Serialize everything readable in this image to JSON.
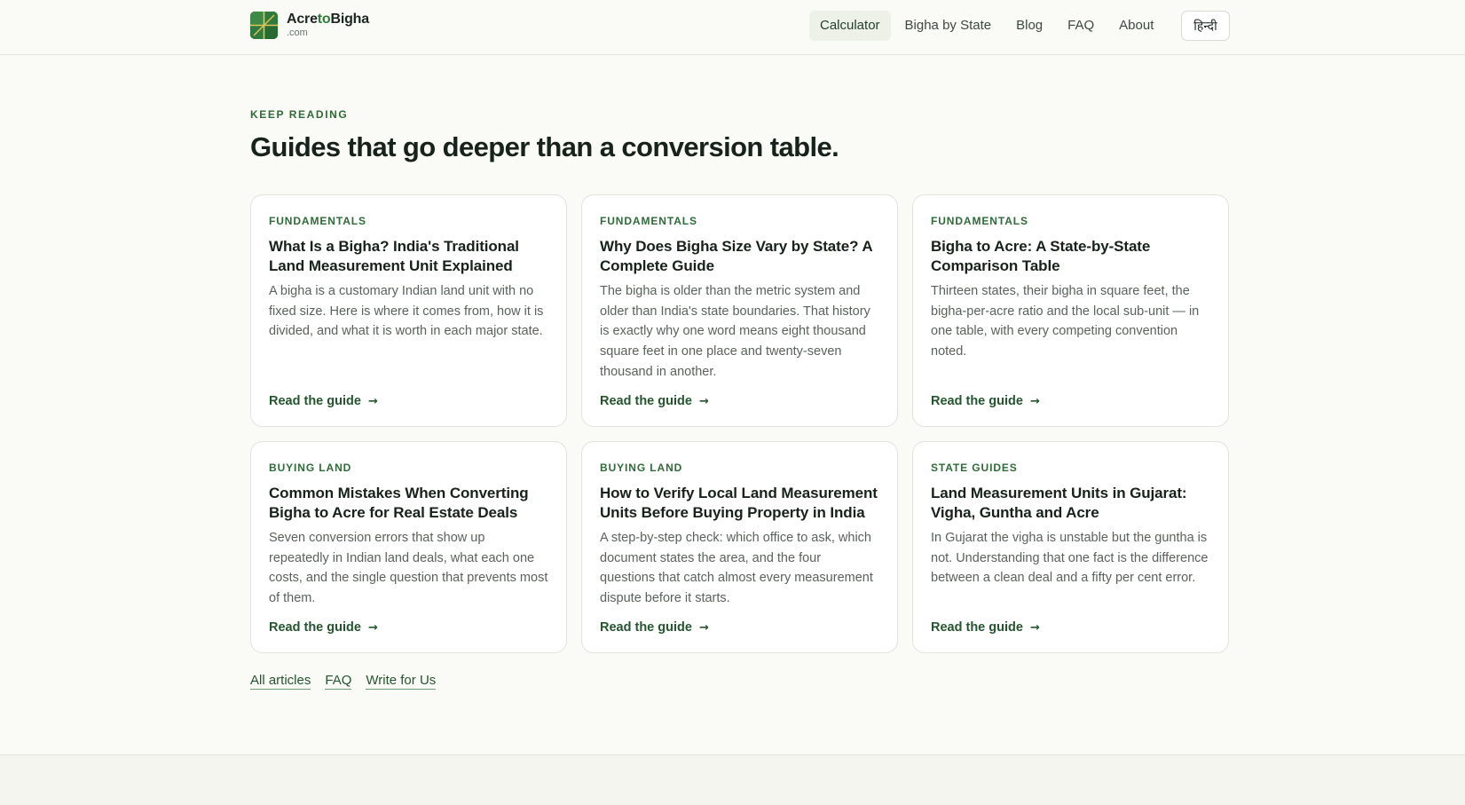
{
  "header": {
    "logo_name_a": "Acre",
    "logo_name_b": "to",
    "logo_name_c": "Bigha",
    "logo_tld": ".com",
    "nav": [
      {
        "label": "Calculator",
        "active": true
      },
      {
        "label": "Bigha by State",
        "active": false
      },
      {
        "label": "Blog",
        "active": false
      },
      {
        "label": "FAQ",
        "active": false
      },
      {
        "label": "About",
        "active": false
      }
    ],
    "language_button": "हिन्दी"
  },
  "section": {
    "eyebrow": "KEEP READING",
    "headline": "Guides that go deeper than a conversion table."
  },
  "articles": [
    {
      "tag": "FUNDAMENTALS",
      "title": "What Is a Bigha? India's Traditional Land Measurement Unit Explained",
      "excerpt": "A bigha is a customary Indian land unit with no fixed size. Here is where it comes from, how it is divided, and what it is worth in each major state.",
      "cta": "Read the guide"
    },
    {
      "tag": "FUNDAMENTALS",
      "title": "Why Does Bigha Size Vary by State? A Complete Guide",
      "excerpt": "The bigha is older than the metric system and older than India's state boundaries. That history is exactly why one word means eight thousand square feet in one place and twenty-seven thousand in another.",
      "cta": "Read the guide"
    },
    {
      "tag": "FUNDAMENTALS",
      "title": "Bigha to Acre: A State-by-State Comparison Table",
      "excerpt": "Thirteen states, their bigha in square feet, the bigha-per-acre ratio and the local sub-unit — in one table, with every competing convention noted.",
      "cta": "Read the guide"
    },
    {
      "tag": "BUYING LAND",
      "title": "Common Mistakes When Converting Bigha to Acre for Real Estate Deals",
      "excerpt": "Seven conversion errors that show up repeatedly in Indian land deals, what each one costs, and the single question that prevents most of them.",
      "cta": "Read the guide"
    },
    {
      "tag": "BUYING LAND",
      "title": "How to Verify Local Land Measurement Units Before Buying Property in India",
      "excerpt": "A step-by-step check: which office to ask, which document states the area, and the four questions that catch almost every measurement dispute before it starts.",
      "cta": "Read the guide"
    },
    {
      "tag": "STATE GUIDES",
      "title": "Land Measurement Units in Gujarat: Vigha, Guntha and Acre",
      "excerpt": "In Gujarat the vigha is unstable but the guntha is not. Understanding that one fact is the difference between a clean deal and a fifty per cent error.",
      "cta": "Read the guide"
    }
  ],
  "footer_links": [
    "All articles",
    "FAQ",
    "Write for Us"
  ],
  "colors": {
    "accent": "#2f7a3c",
    "background": "#fafaf6",
    "card": "#ffffff"
  }
}
